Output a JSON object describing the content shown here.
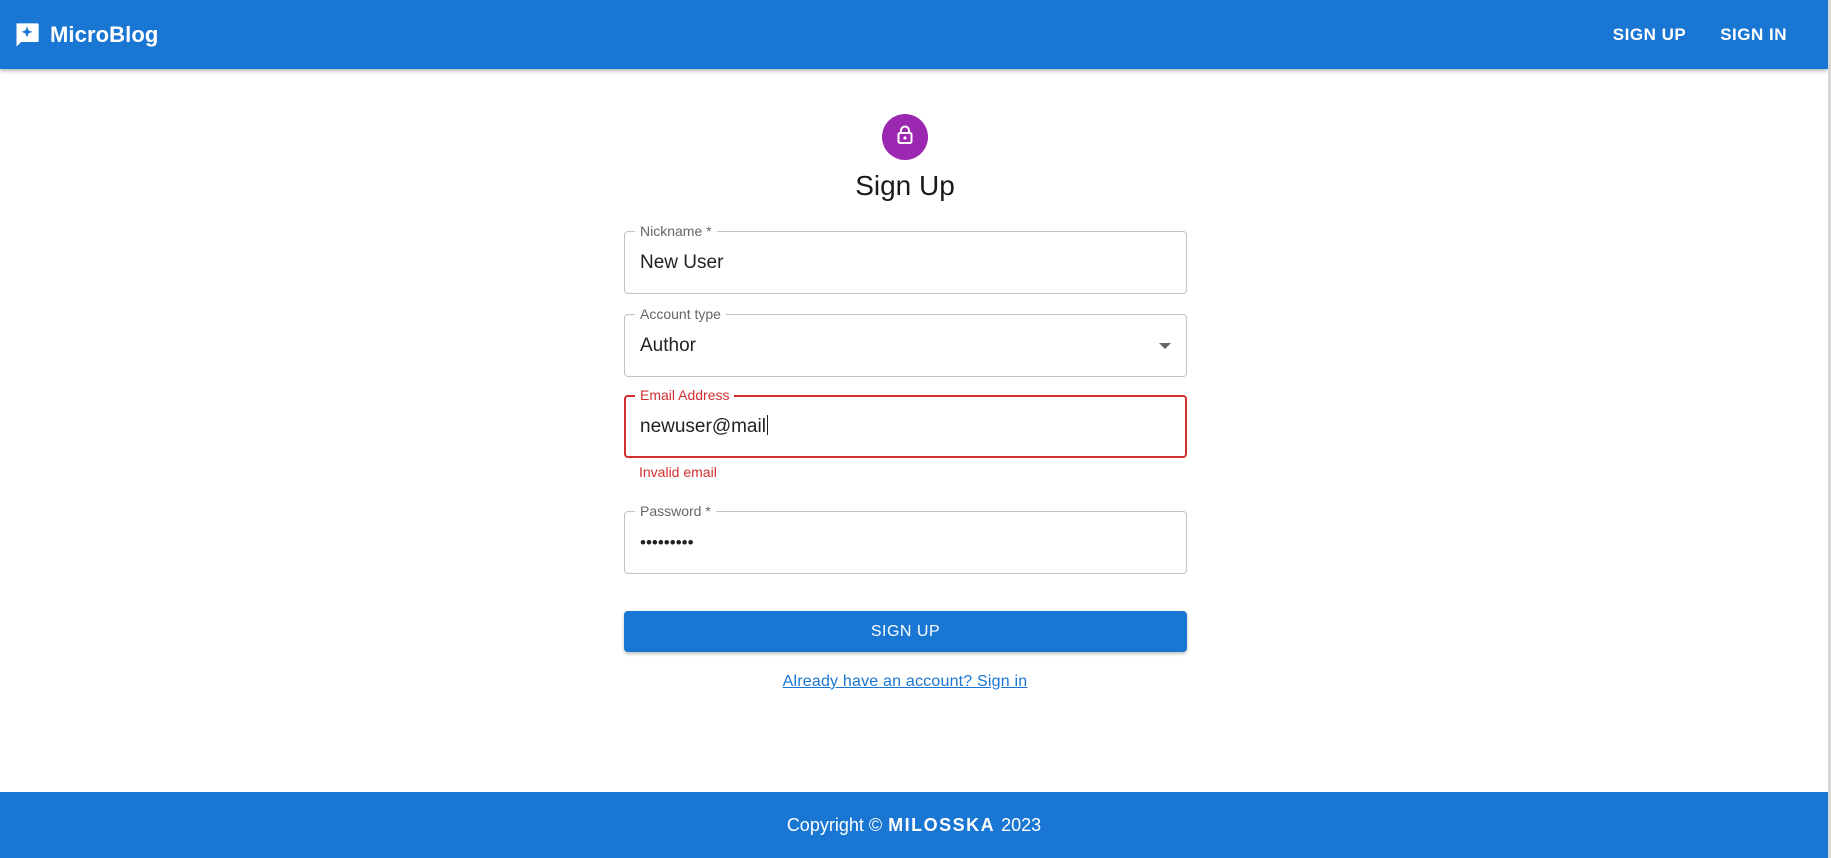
{
  "header": {
    "brand": "MicroBlog",
    "brand_icon": "chat-sparkle-icon",
    "nav": {
      "sign_up": "SIGN UP",
      "sign_in": "SIGN IN"
    }
  },
  "form": {
    "icon": "lock-icon",
    "title": "Sign Up",
    "nickname": {
      "label": "Nickname *",
      "value": "New User"
    },
    "account_type": {
      "label": "Account type",
      "value": "Author"
    },
    "email": {
      "label": "Email Address",
      "value": "newuser@mail",
      "error": "Invalid email"
    },
    "password": {
      "label": "Password *",
      "value": "•••••••••"
    },
    "submit_label": "SIGN UP",
    "signin_link": "Already have an account? Sign in"
  },
  "footer": {
    "prefix": "Copyright ©",
    "owner": "MILOSSKA",
    "year": "2023"
  },
  "colors": {
    "primary": "#1976d2",
    "avatar": "#9c27b0",
    "error": "#d32f2f"
  }
}
